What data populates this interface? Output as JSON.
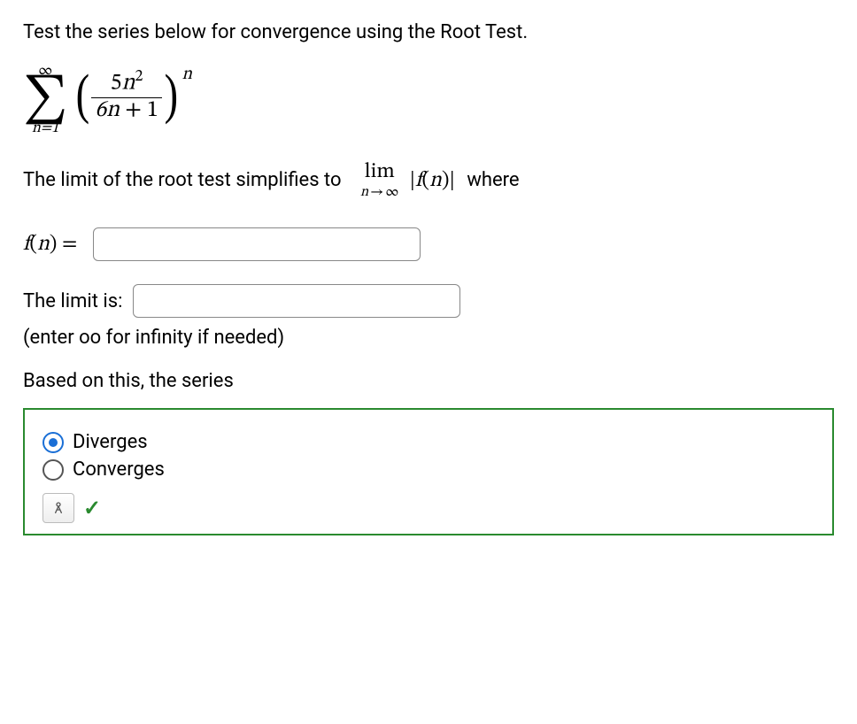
{
  "prompt": "Test the series below for convergence using the Root Test.",
  "series": {
    "sigma_top": "∞",
    "sigma_bottom": "n=1",
    "numerator_coeff": "5",
    "numerator_var": "n",
    "numerator_exp": "2",
    "denominator": "6n + 1",
    "outer_exponent": "n"
  },
  "root_text_before": "The limit of the root test simplifies to",
  "lim_label": "lim",
  "lim_sub_var": "n",
  "lim_sub_arrow": "→",
  "lim_sub_inf": "∞",
  "abs_open": "|",
  "abs_fn": "f",
  "abs_var": "n",
  "abs_close": "|",
  "root_text_after": "where",
  "fn_label_fn": "f",
  "fn_label_var": "n",
  "fn_label_eq": "=",
  "fn_input_value": "",
  "limit_label": "The limit is:",
  "limit_input_value": "",
  "hint": "(enter oo for infinity if needed)",
  "based_text": "Based on this, the series",
  "options": {
    "diverges": "Diverges",
    "converges": "Converges"
  },
  "selected": "diverges",
  "icons": {
    "wand": "⚲",
    "check": "✓"
  }
}
